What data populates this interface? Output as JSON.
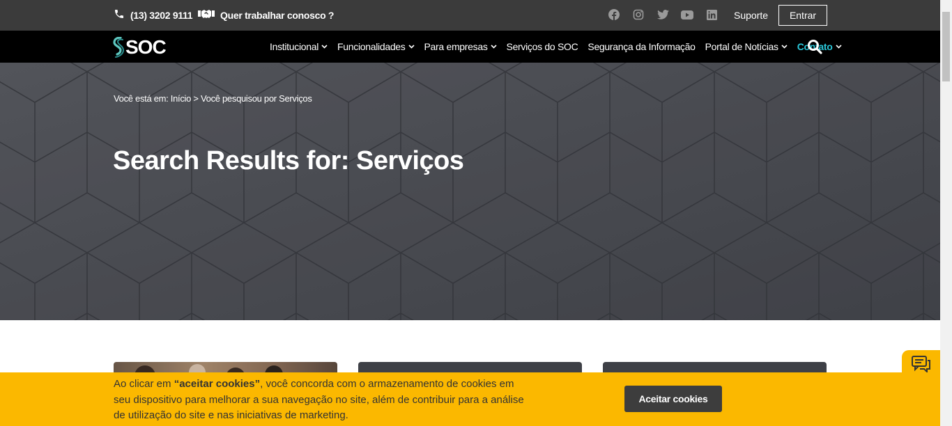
{
  "topbar": {
    "phone": "(13) 3202 9111",
    "work": "Quer trabalhar conosco ?",
    "socials": [
      "facebook-icon",
      "instagram-icon",
      "twitter-icon",
      "youtube-icon",
      "linkedin-icon"
    ],
    "suporte": "Suporte",
    "entrar": "Entrar"
  },
  "nav": {
    "logo": "SOC",
    "items": [
      {
        "label": "Institucional",
        "dropdown": true
      },
      {
        "label": "Funcionalidades",
        "dropdown": true
      },
      {
        "label": "Para empresas",
        "dropdown": true
      },
      {
        "label": "Serviços do SOC",
        "dropdown": false
      },
      {
        "label": "Segurança da Informação",
        "dropdown": false
      },
      {
        "label": "Portal de Notícias",
        "dropdown": true
      },
      {
        "label": "Contato",
        "dropdown": true,
        "active": true
      }
    ]
  },
  "hero": {
    "breadcrumb": "Você está em: Início > Você pesquisou por Serviços",
    "title": "Search Results for: Serviços"
  },
  "cookie": {
    "text_before": "Ao clicar em ",
    "highlight": "“aceitar cookies”",
    "text_after": ", você concorda com o armazenamento de cookies em seu dispositivo para melhorar a sua navegação no site, além de contribuir para a análise de utilização do site e nas iniciativas de marketing.",
    "button": "Aceitar cookies"
  },
  "colors": {
    "topbar": "#3b3b3b",
    "nav": "#000000",
    "accent": "#29c7d9",
    "cookie": "#fbb800"
  }
}
